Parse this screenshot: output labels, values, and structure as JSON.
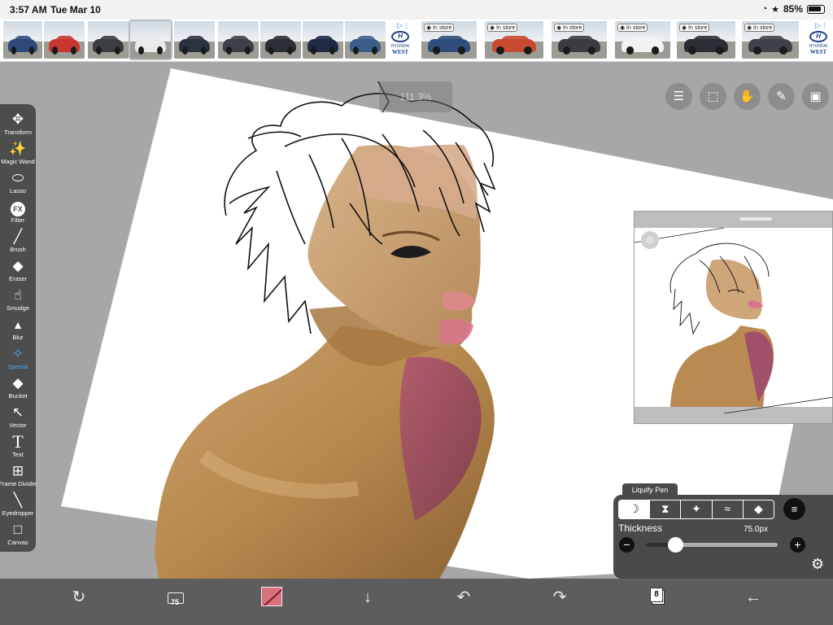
{
  "status": {
    "time": "3:57 AM",
    "date": "Tue Mar 10",
    "battery": "85%"
  },
  "ad": {
    "in_store_label": "In store",
    "brand_text": "HYUNDAI",
    "dealer_text": "WEST",
    "cars": [
      {
        "color": "#2d4a7a"
      },
      {
        "color": "#c8362e"
      },
      {
        "color": "#3a3d42"
      },
      {
        "color": "#e8eaec"
      },
      {
        "color": "#2b3340"
      },
      {
        "color": "#3b4048"
      },
      {
        "color": "#2a3036"
      },
      {
        "color": "#1f2b44"
      },
      {
        "color": "#3b5d8a"
      },
      {
        "color": "#2f4c7a"
      },
      {
        "color": "#c84a30"
      },
      {
        "color": "#3a3c40"
      },
      {
        "color": "#f1f2f4"
      },
      {
        "color": "#2a2d33"
      },
      {
        "color": "#3e4148"
      }
    ]
  },
  "canvas": {
    "zoom": "111.3%"
  },
  "tools": [
    {
      "label": "Transform",
      "icon": "move-arrows-icon"
    },
    {
      "label": "Magic Wand",
      "icon": "magic-wand-icon"
    },
    {
      "label": "Lasso",
      "icon": "lasso-icon"
    },
    {
      "label": "Filter",
      "icon": "fx-icon"
    },
    {
      "label": "Brush",
      "icon": "brush-icon"
    },
    {
      "label": "Eraser",
      "icon": "eraser-icon"
    },
    {
      "label": "Smudge",
      "icon": "smudge-icon"
    },
    {
      "label": "Blur",
      "icon": "drop-icon"
    },
    {
      "label": "Special",
      "icon": "sparkle-icon"
    },
    {
      "label": "Bucket",
      "icon": "bucket-icon"
    },
    {
      "label": "Vector",
      "icon": "pointer-icon"
    },
    {
      "label": "Text",
      "icon": "text-icon"
    },
    {
      "label": "Frame Divider",
      "icon": "frame-divider-icon"
    },
    {
      "label": "Eyedropper",
      "icon": "eyedropper-icon"
    },
    {
      "label": "Canvas",
      "icon": "canvas-icon"
    }
  ],
  "active_tool": "Special",
  "liquify": {
    "title": "Liquify Pen",
    "thickness_label": "Thickness",
    "thickness_value": "75.0px",
    "thickness_fraction": 0.22,
    "modes": [
      "moon-icon",
      "hourglass-icon",
      "pinch-icon",
      "wave-icon",
      "eraser-icon"
    ],
    "active_mode": 0,
    "accent": "#4a4a4a"
  },
  "bottom": {
    "brush_size": "75",
    "color": "#d9717e",
    "layer_count": "8"
  }
}
